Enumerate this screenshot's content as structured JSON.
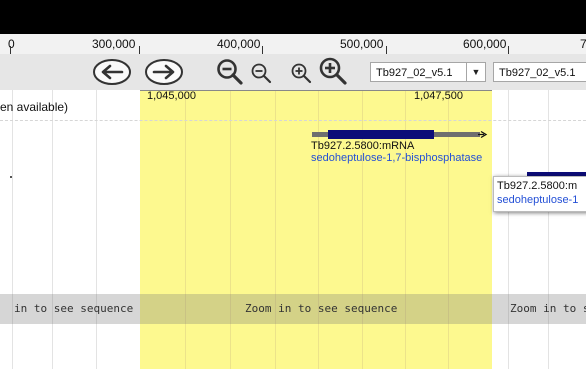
{
  "ruler": {
    "ticks": [
      "0",
      "300,000",
      "400,000",
      "500,000",
      "600,000",
      "7"
    ]
  },
  "navigation": {
    "buttons": [
      "pan-left",
      "pan-right",
      "zoom-out-large",
      "zoom-out-small",
      "zoom-in-small",
      "zoom-in-large"
    ],
    "ref_seq_select": "Tb927_02_v5.1",
    "ref_seq_input": "Tb927_02_v5.1"
  },
  "highlight": {
    "start_label": "1,045,000",
    "end_label": "1,047,500",
    "color": "#fdf98f"
  },
  "track": {
    "status_text": "en available)"
  },
  "features": [
    {
      "name": "Tb927.2.5800:mRNA",
      "description": "sedoheptulose-1,7-bisphosphatase"
    }
  ],
  "popup": {
    "name": "Tb927.2.5800:m",
    "description": "sedoheptulose-1"
  },
  "sequence": {
    "labels": [
      "in to see sequence",
      "Zoom in to see sequence",
      "Zoom in to se"
    ]
  },
  "colors": {
    "feature_thick": "#0c0c78",
    "feature_thin": "#6f6f6f",
    "description_text": "#2450d6"
  }
}
